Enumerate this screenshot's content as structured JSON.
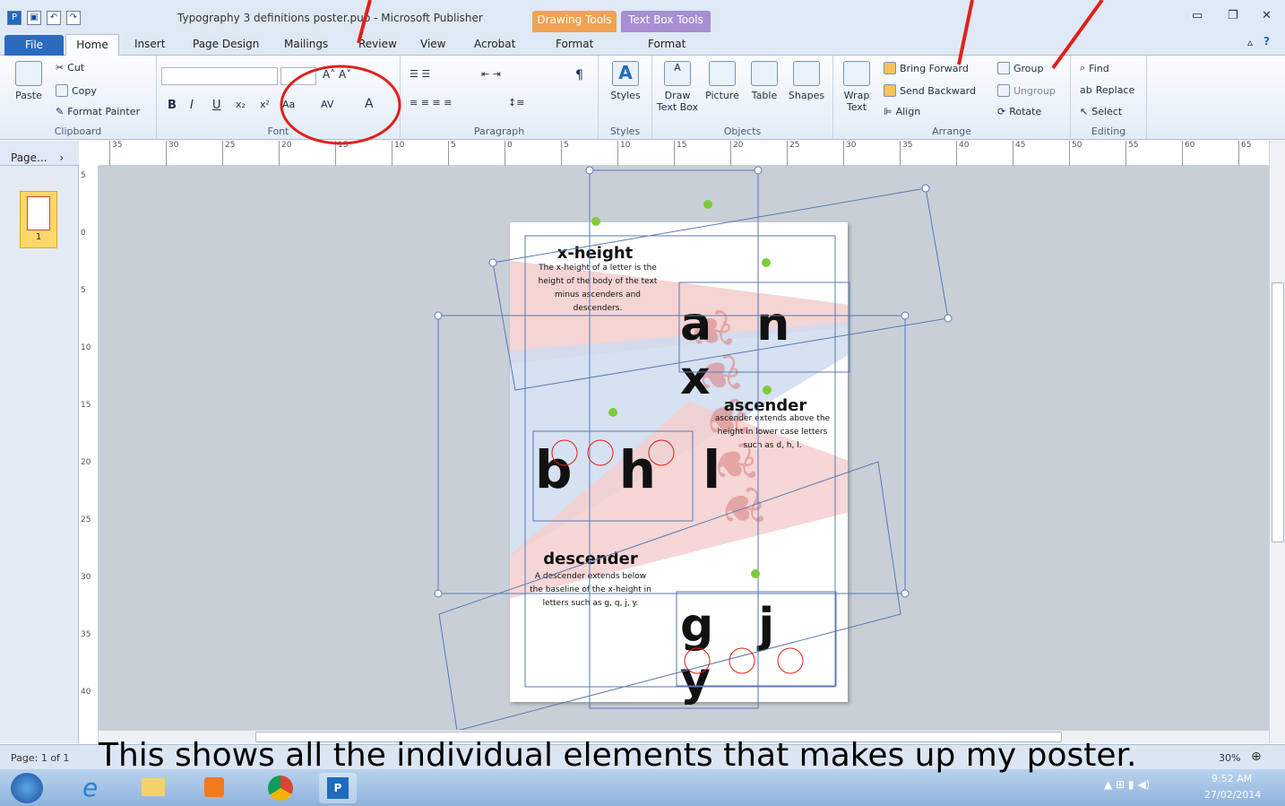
{
  "titlebar": {
    "doc_title": "Typography 3 definitions poster.pub - Microsoft Publisher",
    "context_tab_1": "Drawing Tools",
    "context_tab_2": "Text Box Tools"
  },
  "tabs": [
    "File",
    "Home",
    "Insert",
    "Page Design",
    "Mailings",
    "Review",
    "View",
    "Acrobat",
    "Format",
    "Format"
  ],
  "ribbon": {
    "clipboard": {
      "label": "Clipboard",
      "paste": "Paste",
      "cut": "Cut",
      "copy": "Copy",
      "format_painter": "Format Painter"
    },
    "font": {
      "label": "Font"
    },
    "paragraph": {
      "label": "Paragraph"
    },
    "styles": {
      "label": "Styles",
      "button": "Styles"
    },
    "objects": {
      "label": "Objects",
      "draw_text_box_1": "Draw",
      "draw_text_box_2": "Text Box",
      "picture": "Picture",
      "table": "Table",
      "shapes": "Shapes"
    },
    "arrange": {
      "label": "Arrange",
      "wrap_text_1": "Wrap",
      "wrap_text_2": "Text",
      "bring_forward": "Bring Forward",
      "send_backward": "Send Backward",
      "align": "Align",
      "group": "Group",
      "ungroup": "Ungroup",
      "rotate": "Rotate"
    },
    "editing": {
      "label": "Editing",
      "find": "Find",
      "replace": "Replace",
      "select": "Select"
    }
  },
  "pagepane": {
    "header": "Page...",
    "page_number": "1"
  },
  "ruler_h": [
    "35",
    "30",
    "25",
    "20",
    "15",
    "10",
    "5",
    "0",
    "5",
    "10",
    "15",
    "20",
    "25",
    "30",
    "35",
    "40",
    "45",
    "50",
    "55",
    "60",
    "65"
  ],
  "ruler_v": [
    "5",
    "0",
    "5",
    "10",
    "15",
    "20",
    "25",
    "30",
    "35",
    "40"
  ],
  "poster": {
    "xheight_title": "x-height",
    "xheight_body": "The x-height of a letter is the height of the body of the text minus ascenders and descenders.",
    "anx": "a n x",
    "ascender_title": "ascender",
    "ascender_body": "ascender extends above the height in lower case letters such as d, h, l.",
    "bhl": "b h l",
    "descender_title": "descender",
    "descender_body": "A descender extends below the baseline of the x-height in letters such as g, q, j, y.",
    "gjy": "g j y"
  },
  "status": {
    "page": "Page: 1 of 1",
    "zoom": "30%"
  },
  "taskbar": {
    "time": "9:52 AM",
    "date": "27/02/2014"
  },
  "caption": "This shows all the individual elements that makes up my poster.",
  "colors": {
    "annotation": "#e0201a",
    "file_tab": "#2a6bbf",
    "drawing_tools": "#f0a352",
    "text_box_tools": "#a88ed3"
  }
}
